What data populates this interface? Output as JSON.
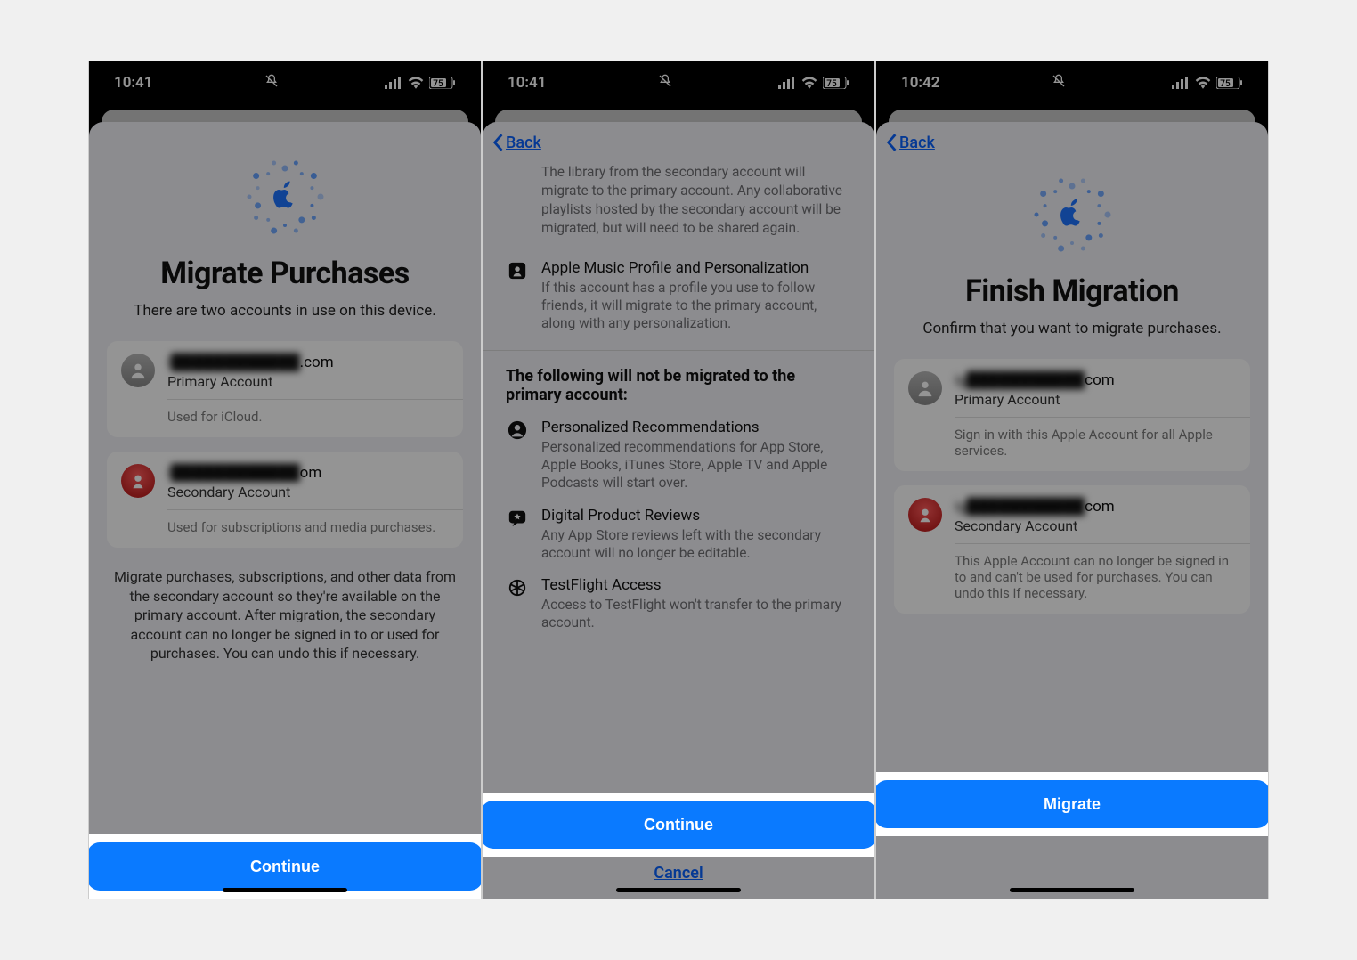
{
  "status": {
    "time1": "10:41",
    "time2": "10:41",
    "time3": "10:42",
    "battery": "75"
  },
  "nav": {
    "back": "Back"
  },
  "panel1": {
    "title": "Migrate Purchases",
    "subtitle": "There are two accounts in use on this device.",
    "acct1_email": "i████████████",
    "acct1_suffix": ".com",
    "acct1_role": "Primary Account",
    "acct1_note": "Used for iCloud.",
    "acct2_email": "i████████████",
    "acct2_suffix": "om",
    "acct2_role": "Secondary Account",
    "acct2_note": "Used for subscriptions and media purchases.",
    "explain": "Migrate purchases, subscriptions, and other data from the secondary account so they're available on the primary account. After migration, the secondary account can no longer be signed in to or used for purchases. You can undo this if necessary.",
    "btn": "Continue"
  },
  "panel2": {
    "intro_note": "The library from the secondary account will migrate to the primary account. Any collaborative playlists hosted by the secondary account will be migrated, but will need to be shared again.",
    "item0_hd": "Apple Music Profile and Personalization",
    "item0_sub": "If this account has a profile you use to follow friends, it will migrate to the primary account, along with any personalization.",
    "section2_title": "The following will not be migrated to the primary account:",
    "item1_hd": "Personalized Recommendations",
    "item1_sub": "Personalized recommendations for App Store, Apple Books, iTunes Store, Apple TV and Apple Podcasts will start over.",
    "item2_hd": "Digital Product Reviews",
    "item2_sub": "Any App Store reviews left with the secondary account will no longer be editable.",
    "item3_hd": "TestFlight Access",
    "item3_sub": "Access to TestFlight won't transfer to the primary account.",
    "btn": "Continue",
    "cancel": "Cancel"
  },
  "panel3": {
    "title": "Finish Migration",
    "subtitle": "Confirm that you want to migrate purchases.",
    "acct1_email": "ig███████████",
    "acct1_suffix": "com",
    "acct1_role": "Primary Account",
    "acct1_note": "Sign in with this Apple Account for all Apple services.",
    "acct2_email": "ig███████████",
    "acct2_suffix": "com",
    "acct2_role": "Secondary Account",
    "acct2_note": "This Apple Account can no longer be signed in to and can't be used for purchases. You can undo this if necessary.",
    "btn": "Migrate"
  }
}
